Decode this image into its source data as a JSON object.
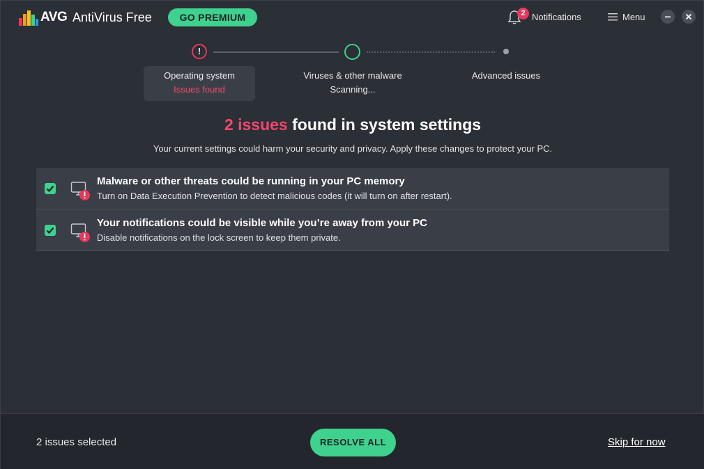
{
  "app": {
    "brand": "AVG",
    "product": "AntiVirus Free",
    "premium_button": "GO PREMIUM",
    "notifications_label": "Notifications",
    "notifications_count": "2",
    "menu_label": "Menu"
  },
  "colors": {
    "accent_green": "#3fd18e",
    "alert_red": "#f1476b",
    "background": "#2b2f36",
    "row_background": "#3a3f47",
    "footer_background": "#23272d"
  },
  "steps": [
    {
      "title": "Operating system",
      "status": "Issues found",
      "state": "active-issue",
      "icon": "exclamation-icon"
    },
    {
      "title": "Viruses & other malware",
      "status": "Scanning...",
      "state": "in-progress",
      "icon": "progress-ring-icon"
    },
    {
      "title": "Advanced issues",
      "status": "",
      "state": "pending",
      "icon": "dot-icon"
    }
  ],
  "headline": {
    "count_text": "2 issues",
    "rest_text": " found in system settings",
    "subtitle": "Your current settings could harm your security and privacy. Apply these changes to protect your PC."
  },
  "issues": [
    {
      "checked": true,
      "title": "Malware or other threats could be running in your PC memory",
      "description": "Turn on Data Execution Prevention to detect malicious codes (it will turn on after restart).",
      "icon": "monitor-alert-icon"
    },
    {
      "checked": true,
      "title": "Your notifications could be visible while you’re away from your PC",
      "description": "Disable notifications on the lock screen to keep them private.",
      "icon": "monitor-alert-icon"
    }
  ],
  "footer": {
    "selected_text": "2 issues selected",
    "resolve_button": "RESOLVE ALL",
    "skip_link": "Skip for now"
  }
}
